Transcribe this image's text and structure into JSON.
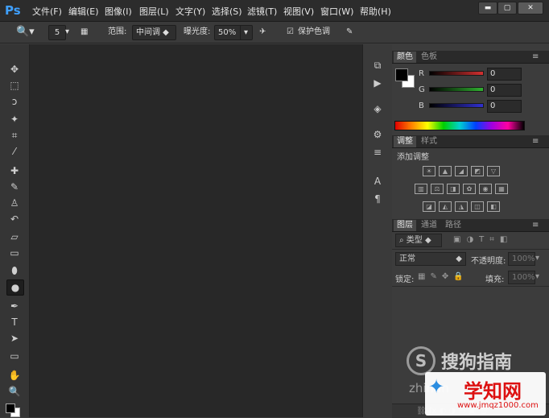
{
  "app": {
    "logo": "Ps"
  },
  "menubar": {
    "items": [
      "文件(F)",
      "编辑(E)",
      "图像(I)",
      "图层(L)",
      "文字(Y)",
      "选择(S)",
      "滤镜(T)",
      "视图(V)",
      "窗口(W)",
      "帮助(H)"
    ],
    "window_buttons": {
      "minimize": "▬",
      "restore": "▢",
      "close": "✕"
    }
  },
  "options_bar": {
    "brush_size": "5",
    "range_label": "范围:",
    "range_value": "中间调",
    "exposure_label": "曝光度:",
    "exposure_value": "50%",
    "protect_tones_label": "保护色调",
    "protect_tones_checked": true
  },
  "tools": [
    {
      "name": "move-tool-icon",
      "glyph": "✥"
    },
    {
      "name": "marquee-tool-icon",
      "glyph": "⬚"
    },
    {
      "name": "lasso-tool-icon",
      "glyph": "ↄ"
    },
    {
      "name": "magic-wand-tool-icon",
      "glyph": "✦"
    },
    {
      "name": "crop-tool-icon",
      "glyph": "⌗"
    },
    {
      "name": "eyedropper-tool-icon",
      "glyph": "⁄"
    },
    {
      "name": "healing-brush-tool-icon",
      "glyph": "✚"
    },
    {
      "name": "brush-tool-icon",
      "glyph": "✎"
    },
    {
      "name": "clone-stamp-tool-icon",
      "glyph": "♙"
    },
    {
      "name": "history-brush-tool-icon",
      "glyph": "↶"
    },
    {
      "name": "eraser-tool-icon",
      "glyph": "▱"
    },
    {
      "name": "gradient-tool-icon",
      "glyph": "▭"
    },
    {
      "name": "blur-tool-icon",
      "glyph": "⬮"
    },
    {
      "name": "dodge-tool-icon",
      "glyph": "●"
    },
    {
      "name": "pen-tool-icon",
      "glyph": "✒"
    },
    {
      "name": "type-tool-icon",
      "glyph": "T"
    },
    {
      "name": "path-selection-tool-icon",
      "glyph": "➤"
    },
    {
      "name": "shape-tool-icon",
      "glyph": "▭"
    },
    {
      "name": "hand-tool-icon",
      "glyph": "✋"
    },
    {
      "name": "zoom-tool-icon",
      "glyph": "🔍"
    }
  ],
  "collapsed_panel_icons": [
    {
      "name": "history-panel-icon",
      "glyph": "⧉"
    },
    {
      "name": "actions-panel-icon",
      "glyph": "▶"
    },
    {
      "name": "3d-panel-icon",
      "glyph": "◈"
    },
    {
      "name": "tool-presets-panel-icon",
      "glyph": "⚙"
    },
    {
      "name": "brush-presets-panel-icon",
      "glyph": "≡"
    },
    {
      "name": "character-panel-icon",
      "glyph": "A"
    },
    {
      "name": "paragraph-panel-icon",
      "glyph": "¶"
    }
  ],
  "color_panel": {
    "tabs": [
      "颜色",
      "色板"
    ],
    "channels": [
      {
        "label": "R",
        "value": "0",
        "color": "#d23030"
      },
      {
        "label": "G",
        "value": "0",
        "color": "#30b030"
      },
      {
        "label": "B",
        "value": "0",
        "color": "#3030d0"
      }
    ]
  },
  "adjustments_panel": {
    "tabs": [
      "调整",
      "样式"
    ],
    "title": "添加调整"
  },
  "layers_panel": {
    "tabs": [
      "图层",
      "通道",
      "路径"
    ],
    "filter_kind": "类型",
    "blend_mode": "正常",
    "opacity_label": "不透明度:",
    "opacity_value": "100%",
    "lock_label": "锁定:",
    "fill_label": "填充:",
    "fill_value": "100%"
  },
  "watermark": {
    "sogou": "搜狗指南",
    "zhinan": "zhinan",
    "xuezhiwang": "学知网",
    "url": "www.jmqz1000.com"
  },
  "colors": {
    "accent": "#3fa0ff",
    "canvas": "#282828",
    "chrome": "#3c3c3c"
  }
}
